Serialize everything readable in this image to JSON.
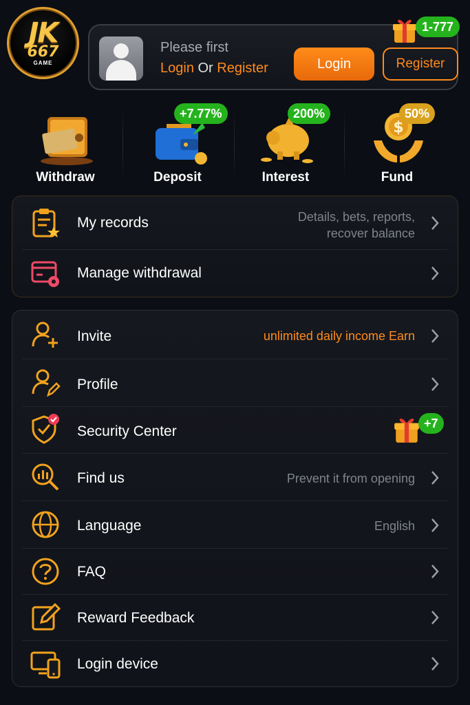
{
  "brand": {
    "logo_main": "JK",
    "logo_num": "667",
    "logo_sub": "GAME"
  },
  "header": {
    "prompt": "Please first",
    "login_link": "Login",
    "or_text": "Or",
    "register_link": "Register",
    "login_button": "Login",
    "register_button": "Register",
    "gift_badge": "1-777"
  },
  "quick_actions": [
    {
      "label": "Withdraw",
      "badge": ""
    },
    {
      "label": "Deposit",
      "badge": "+7.77%"
    },
    {
      "label": "Interest",
      "badge": "200%"
    },
    {
      "label": "Fund",
      "badge": "50%"
    }
  ],
  "records_menu": [
    {
      "label": "My records",
      "hint_line1": "Details, bets, reports,",
      "hint_line2": "recover balance",
      "icon": "clipboard-star-icon"
    },
    {
      "label": "Manage withdrawal",
      "hint": "",
      "icon": "card-gear-icon"
    }
  ],
  "main_menu": [
    {
      "label": "Invite",
      "hint": "unlimited daily income Earn",
      "icon": "user-plus-icon"
    },
    {
      "label": "Profile",
      "hint": "",
      "icon": "user-edit-icon"
    },
    {
      "label": "Security Center",
      "hint": "",
      "badge": "+7",
      "icon": "shield-check-icon"
    },
    {
      "label": "Find us",
      "hint": "Prevent it from opening",
      "icon": "search-chart-icon"
    },
    {
      "label": "Language",
      "hint": "English",
      "icon": "globe-icon"
    },
    {
      "label": "FAQ",
      "hint": "",
      "icon": "question-icon"
    },
    {
      "label": "Reward Feedback",
      "hint": "",
      "icon": "edit-box-icon"
    },
    {
      "label": "Login device",
      "hint": "",
      "icon": "devices-icon"
    }
  ],
  "colors": {
    "accent": "#ff8a1e",
    "badge_green": "#25b31d",
    "background": "#0b0e14"
  }
}
